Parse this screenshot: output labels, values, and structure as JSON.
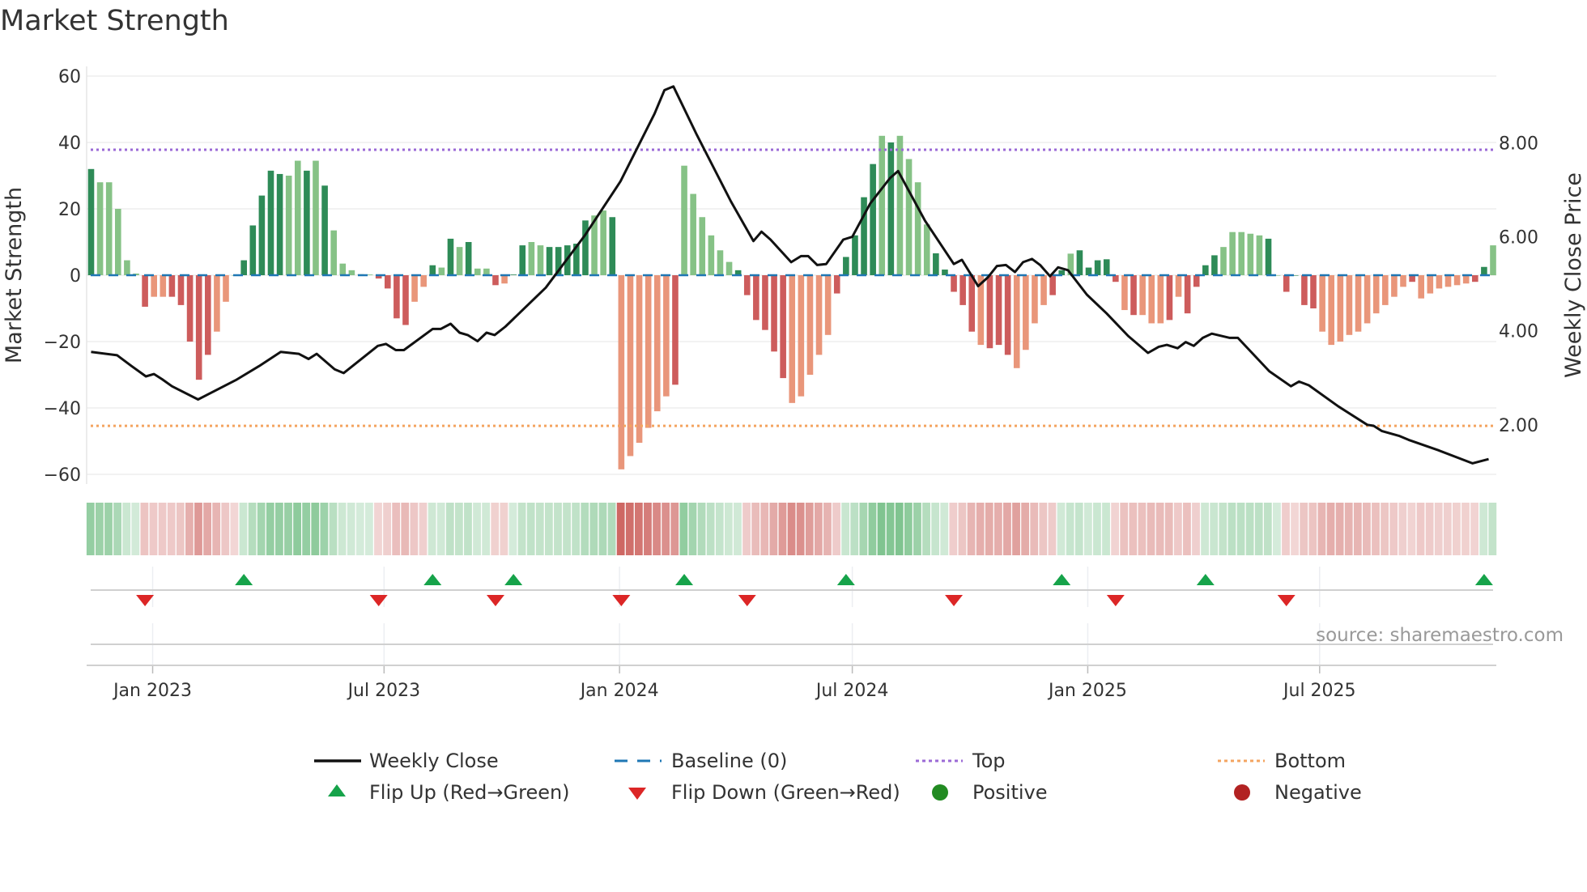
{
  "title": "Market Strength",
  "source": "source: sharemaestro.com",
  "chart_data": {
    "type": "bar",
    "title": "Market Strength",
    "ylabel": "Market Strength",
    "y2label": "Weekly Close Price",
    "ylim": [
      -60,
      60
    ],
    "y2lim": [
      0.946,
      9.42
    ],
    "yticks": [
      60,
      40,
      20,
      0,
      -20,
      -40,
      -60
    ],
    "yticklabels": [
      "60",
      "40",
      "20",
      "0",
      "−20",
      "−40",
      "−60"
    ],
    "y2ticks": [
      8,
      6,
      4,
      2
    ],
    "y2ticklabels": [
      "8.00",
      "6.00",
      "4.00",
      "2.00"
    ],
    "xticks": [
      {
        "week": 6.85,
        "label": "Jan 2023"
      },
      {
        "week": 32.6,
        "label": "Jul 2023"
      },
      {
        "week": 58.8,
        "label": "Jan 2024"
      },
      {
        "week": 84.7,
        "label": "Jul 2024"
      },
      {
        "week": 110.9,
        "label": "Jan 2025"
      },
      {
        "week": 136.7,
        "label": "Jul 2025"
      }
    ],
    "top_level": 37.8,
    "bottom_level": -45.4,
    "baseline": 0,
    "colors": {
      "pos_dark": "#2e8b57",
      "pos_light": "#86c286",
      "neg_dark": "#cd5c5c",
      "neg_light": "#e9967a",
      "top": "#9b6ad6",
      "bottom": "#f4a460",
      "baseline": "#1f77b4",
      "line": "#111111",
      "flip_up": "#16a34a",
      "flip_down": "#dc2626",
      "positive": "#228b22",
      "negative": "#b22222"
    },
    "strength": [
      32,
      28,
      28,
      20,
      4.5,
      0.5,
      -9.5,
      -6.5,
      -6.5,
      -6.5,
      -9,
      -20,
      -31.5,
      -24,
      -17,
      -8,
      0,
      4.5,
      15,
      24,
      31.5,
      30.5,
      30,
      34.5,
      31.5,
      34.5,
      27,
      13.5,
      3.5,
      1.5,
      0.3,
      0.2,
      -1,
      -4,
      -13,
      -15,
      -8,
      -3.5,
      3,
      2.3,
      11,
      8.5,
      10,
      2,
      2,
      -3,
      -2.5,
      0.2,
      9,
      10,
      9,
      8.5,
      8.5,
      9,
      9.5,
      16.5,
      18,
      19.5,
      17.5,
      -58.5,
      -54.5,
      -50.5,
      -46,
      -41,
      -36.5,
      -33,
      33,
      24.5,
      17.5,
      12,
      7.5,
      4,
      1.5,
      -6,
      -13.5,
      -16.5,
      -23,
      -31,
      -38.5,
      -36.5,
      -30,
      -24,
      -18,
      -5.5,
      5.5,
      12,
      23.5,
      33.5,
      42,
      40,
      42,
      35,
      28,
      15.3,
      6.6,
      1.7,
      -5,
      -9,
      -17,
      -21,
      -22,
      -21,
      -24,
      -28,
      -22.5,
      -14.5,
      -9,
      -6,
      1.5,
      6.5,
      7.5,
      2.3,
      4.5,
      4.8,
      -2,
      -10.5,
      -12,
      -12,
      -14.5,
      -14.5,
      -13.5,
      -6.5,
      -11.5,
      -3.5,
      3,
      6,
      8.5,
      13,
      13,
      12.5,
      12,
      11,
      0,
      -5,
      0,
      -9,
      -10,
      -17,
      -21,
      -20,
      -18,
      -17,
      -14.5,
      -11.5,
      -9,
      -6.5,
      -3.5,
      -2,
      -7,
      -5.5,
      -4,
      -3.5,
      -3,
      -2.5,
      -2,
      2.5,
      9
    ],
    "shade": "dllllldlldddddllldddddlldldlllllddddlldldldlldlddlldddddlldlllllldllllllddddddllllldddddldlllldddddldddllllddldddddldllldlddddllllldlddddlllllllllldlllllldd",
    "price_points": [
      [
        0,
        3.55
      ],
      [
        2.9,
        3.48
      ],
      [
        4.5,
        3.25
      ],
      [
        6.1,
        3.03
      ],
      [
        7,
        3.08
      ],
      [
        7.9,
        2.97
      ],
      [
        9,
        2.82
      ],
      [
        11.9,
        2.54
      ],
      [
        16.1,
        2.95
      ],
      [
        18.7,
        3.25
      ],
      [
        21.1,
        3.55
      ],
      [
        23.1,
        3.51
      ],
      [
        24.2,
        3.4
      ],
      [
        25.1,
        3.51
      ],
      [
        27.1,
        3.18
      ],
      [
        28.1,
        3.1
      ],
      [
        31.9,
        3.68
      ],
      [
        32.8,
        3.72
      ],
      [
        33.9,
        3.59
      ],
      [
        34.8,
        3.59
      ],
      [
        38,
        4.04
      ],
      [
        38.9,
        4.04
      ],
      [
        40,
        4.15
      ],
      [
        41,
        3.96
      ],
      [
        41.9,
        3.91
      ],
      [
        43,
        3.78
      ],
      [
        44,
        3.96
      ],
      [
        44.9,
        3.91
      ],
      [
        46.1,
        4.09
      ],
      [
        50.6,
        4.92
      ],
      [
        54.9,
        6.02
      ],
      [
        58.9,
        7.18
      ],
      [
        62.7,
        8.62
      ],
      [
        63.8,
        9.12
      ],
      [
        64.8,
        9.2
      ],
      [
        67.4,
        8.17
      ],
      [
        71.2,
        6.75
      ],
      [
        73.7,
        5.91
      ],
      [
        74.6,
        6.11
      ],
      [
        75.6,
        5.94
      ],
      [
        77.9,
        5.46
      ],
      [
        79,
        5.59
      ],
      [
        79.8,
        5.59
      ],
      [
        80.8,
        5.4
      ],
      [
        81.8,
        5.42
      ],
      [
        83.7,
        5.94
      ],
      [
        84.7,
        6.0
      ],
      [
        86.7,
        6.71
      ],
      [
        88.9,
        7.25
      ],
      [
        89.8,
        7.4
      ],
      [
        92.8,
        6.34
      ],
      [
        96,
        5.42
      ],
      [
        96.9,
        5.51
      ],
      [
        98.7,
        4.95
      ],
      [
        99.8,
        5.14
      ],
      [
        100.8,
        5.38
      ],
      [
        101.8,
        5.4
      ],
      [
        102.8,
        5.25
      ],
      [
        103.7,
        5.46
      ],
      [
        104.7,
        5.53
      ],
      [
        105.6,
        5.4
      ],
      [
        106.7,
        5.16
      ],
      [
        107.6,
        5.35
      ],
      [
        108.7,
        5.29
      ],
      [
        110.8,
        4.77
      ],
      [
        113,
        4.37
      ],
      [
        115.4,
        3.89
      ],
      [
        117.6,
        3.53
      ],
      [
        118.8,
        3.66
      ],
      [
        119.7,
        3.7
      ],
      [
        120.9,
        3.63
      ],
      [
        121.8,
        3.76
      ],
      [
        122.7,
        3.68
      ],
      [
        123.7,
        3.85
      ],
      [
        124.7,
        3.94
      ],
      [
        126.7,
        3.85
      ],
      [
        127.6,
        3.85
      ],
      [
        131.1,
        3.14
      ],
      [
        133.5,
        2.82
      ],
      [
        134.4,
        2.92
      ],
      [
        135.5,
        2.84
      ],
      [
        138.8,
        2.39
      ],
      [
        142,
        2.0
      ],
      [
        142.7,
        1.98
      ],
      [
        143.6,
        1.87
      ],
      [
        145.6,
        1.76
      ],
      [
        146.6,
        1.68
      ],
      [
        149.9,
        1.46
      ],
      [
        153.7,
        1.18
      ],
      [
        155.5,
        1.27
      ]
    ],
    "flips_up": [
      17,
      38,
      47,
      66,
      84,
      108,
      124,
      155
    ],
    "flips_down": [
      6,
      32,
      45,
      59,
      73,
      96,
      114,
      133
    ],
    "legend": {
      "placement": "bottom",
      "items": [
        {
          "key": "line",
          "label": "Weekly Close"
        },
        {
          "key": "baseline",
          "label": "Baseline (0)"
        },
        {
          "key": "top",
          "label": "Top"
        },
        {
          "key": "bottom",
          "label": "Bottom"
        },
        {
          "key": "flip_up",
          "label": "Flip Up (Red→Green)"
        },
        {
          "key": "flip_down",
          "label": "Flip Down (Green→Red)"
        },
        {
          "key": "positive",
          "label": "Positive"
        },
        {
          "key": "negative",
          "label": "Negative"
        }
      ]
    }
  }
}
